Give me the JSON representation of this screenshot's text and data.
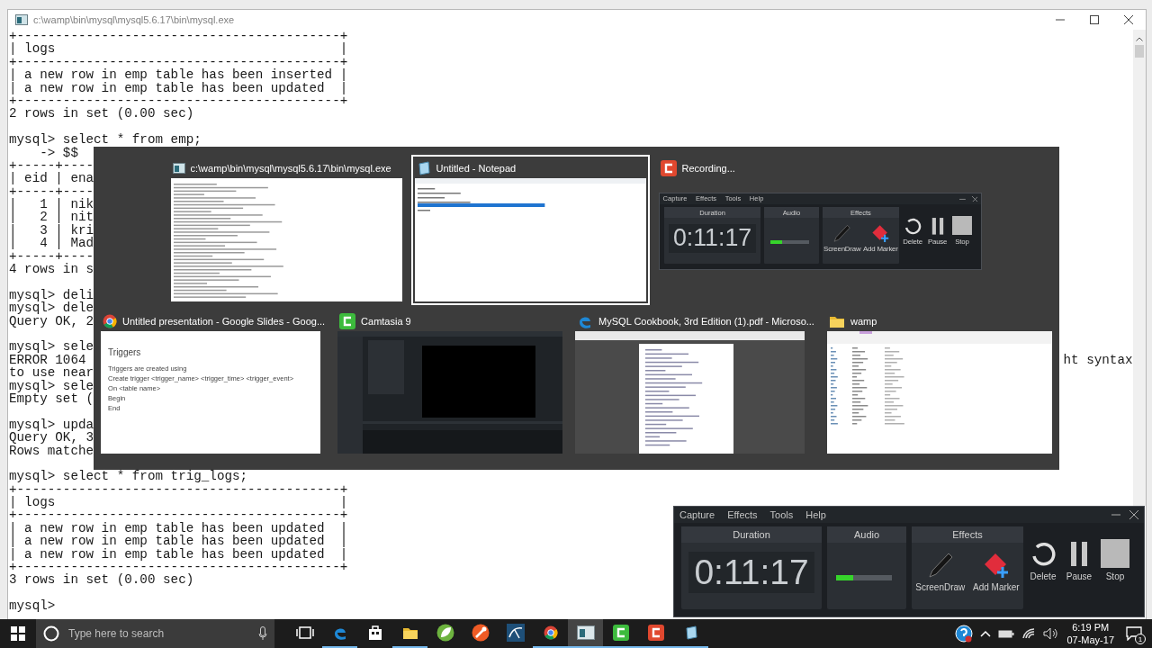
{
  "console": {
    "title": "c:\\wamp\\bin\\mysql\\mysql5.6.17\\bin\\mysql.exe",
    "blocks": [
      [
        {
          "text": "+------------------------------------------+"
        },
        {
          "text": "| logs                                     |"
        },
        {
          "text": "+------------------------------------------+"
        },
        {
          "text": "| a new row in emp table has been inserted |"
        },
        {
          "text": "| a new row in emp table has been updated  |"
        },
        {
          "text": "+------------------------------------------+"
        },
        {
          "text": "2 rows in set (0.00 sec)"
        }
      ],
      [
        {
          "text": "mysql> select * from emp;"
        },
        {
          "text": "    -> $$"
        },
        {
          "text": "+-----+----"
        },
        {
          "text": "| eid | ena"
        },
        {
          "text": "+-----+----"
        },
        {
          "text": "|   1 | nik"
        },
        {
          "text": "|   2 | nit"
        },
        {
          "text": "|   3 | kri"
        },
        {
          "text": "|   4 | Mad"
        },
        {
          "text": "+-----+----"
        },
        {
          "text": "4 rows in s"
        }
      ],
      [
        {
          "text": "mysql> deli"
        },
        {
          "text": "mysql> dele"
        },
        {
          "text": "Query OK, 2"
        }
      ],
      [
        {
          "text": "mysql> sele"
        },
        {
          "text": "ERROR 1064",
          "tail": "ht syntax"
        },
        {
          "text": "to use near"
        },
        {
          "text": "mysql> sele"
        },
        {
          "text": "Empty set ("
        }
      ],
      [
        {
          "text": "mysql> upda"
        },
        {
          "text": "Query OK, 3"
        },
        {
          "text": "Rows matche"
        }
      ],
      [
        {
          "text": "mysql> select * from trig_logs;"
        },
        {
          "text": "+------------------------------------------+"
        },
        {
          "text": "| logs                                     |"
        },
        {
          "text": "+------------------------------------------+"
        },
        {
          "text": "| a new row in emp table has been updated  |"
        },
        {
          "text": "| a new row in emp table has been updated  |"
        },
        {
          "text": "| a new row in emp table has been updated  |"
        },
        {
          "text": "+------------------------------------------+"
        },
        {
          "text": "3 rows in set (0.00 sec)"
        }
      ],
      [
        {
          "text": "mysql>"
        }
      ]
    ]
  },
  "switcher": {
    "rows": [
      [
        {
          "title": "c:\\wamp\\bin\\mysql\\mysql5.6.17\\bin\\mysql.exe",
          "kind": "console",
          "selected": false
        },
        {
          "title": "Untitled - Notepad",
          "kind": "notepad",
          "selected": true
        },
        {
          "title": "Recording...",
          "kind": "recorder",
          "selected": false,
          "recorder": {
            "menu": [
              "Capture",
              "Effects",
              "Tools",
              "Help"
            ],
            "duration": {
              "label": "Duration",
              "time": "0:11:17"
            },
            "audio": {
              "label": "Audio",
              "level": 0.3
            },
            "effects": {
              "label": "Effects",
              "items": [
                "ScreenDraw",
                "Add Marker"
              ]
            },
            "buttons": [
              "Delete",
              "Pause",
              "Stop"
            ]
          }
        }
      ],
      [
        {
          "title": "Untitled presentation - Google Slides - Goog...",
          "kind": "slides",
          "selected": false,
          "slide": {
            "heading": "Triggers",
            "lines": [
              "Triggers are created using",
              "Create trigger <trigger_name> <trigger_time> <trigger_event>",
              "On <table name>",
              "Begin",
              "End"
            ]
          }
        },
        {
          "title": "Camtasia 9",
          "kind": "editor",
          "selected": false
        },
        {
          "title": "MySQL Cookbook, 3rd Edition (1).pdf - Microso...",
          "kind": "pdf",
          "selected": false
        },
        {
          "title": "wamp",
          "kind": "explorer",
          "selected": false
        }
      ]
    ]
  },
  "recorder": {
    "menu": [
      "Capture",
      "Effects",
      "Tools",
      "Help"
    ],
    "duration": {
      "label": "Duration",
      "time": "0:11:17"
    },
    "audio": {
      "label": "Audio",
      "level": 0.3
    },
    "effects": {
      "label": "Effects",
      "items": [
        "ScreenDraw",
        "Add Marker"
      ]
    },
    "buttons": [
      "Delete",
      "Pause",
      "Stop"
    ]
  },
  "taskbar": {
    "search": {
      "placeholder": "Type here to search"
    },
    "apps": [
      {
        "running": true,
        "selected": false
      },
      {
        "running": false,
        "selected": false
      },
      {
        "running": true,
        "selected": false
      },
      {
        "running": false,
        "selected": false
      },
      {
        "running": false,
        "selected": false
      },
      {
        "running": false,
        "selected": false
      },
      {
        "running": true,
        "selected": false
      },
      {
        "running": true,
        "selected": true
      },
      {
        "running": true,
        "selected": false
      },
      {
        "running": true,
        "selected": false
      },
      {
        "running": true,
        "selected": false
      }
    ],
    "time": "6:19 PM",
    "date": "07-May-17",
    "notifications": "1"
  }
}
